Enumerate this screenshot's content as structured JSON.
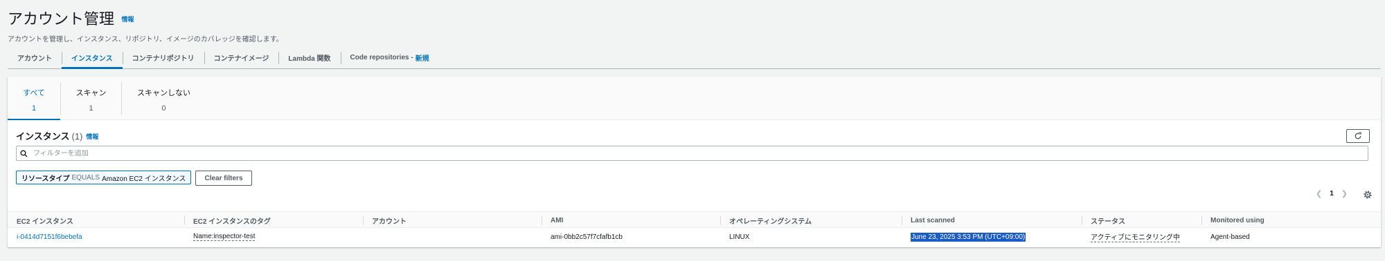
{
  "header": {
    "title": "アカウント管理",
    "info": "情報",
    "description": "アカウントを管理し、インスタンス、リポジトリ、イメージのカバレッジを確認します。"
  },
  "tabs": [
    {
      "label": "アカウント",
      "active": false
    },
    {
      "label": "インスタンス",
      "active": true
    },
    {
      "label": "コンテナリポジトリ",
      "active": false
    },
    {
      "label": "コンテナイメージ",
      "active": false
    },
    {
      "label": "Lambda 関数",
      "active": false
    },
    {
      "label": "Code repositories -",
      "suffix": "新規",
      "active": false
    }
  ],
  "segments": [
    {
      "label": "すべて",
      "count": "1",
      "active": true
    },
    {
      "label": "スキャン",
      "count": "1",
      "active": false
    },
    {
      "label": "スキャンしない",
      "count": "0",
      "active": false
    }
  ],
  "table": {
    "title": "インスタンス",
    "count": "(1)",
    "info": "情報",
    "search_placeholder": "フィルターを追加",
    "filter_token": {
      "key": "リソースタイプ",
      "operator": "EQUALS",
      "value": "Amazon EC2 インスタンス"
    },
    "clear_filters": "Clear filters",
    "page": "1",
    "columns": [
      "EC2 インスタンス",
      "EC2 インスタンスのタグ",
      "アカウント",
      "AMI",
      "オペレーティングシステム",
      "Last scanned",
      "ステータス",
      "Monitored using"
    ],
    "rows": [
      {
        "instance": "i-0414d7151f6bebefa",
        "tags": "Name:inspector-test",
        "account": "",
        "ami": "ami-0bb2c57f7cfafb1cb",
        "os": "LINUX",
        "last_scanned": "June 23, 2025 3:53 PM (UTC+09:00)",
        "status": "アクティブにモニタリング中",
        "monitored_using": "Agent-based"
      }
    ]
  },
  "icons": {
    "search": "search-icon",
    "refresh": "refresh-icon",
    "settings": "gear-icon",
    "prev": "chevron-left-icon",
    "next": "chevron-right-icon"
  },
  "colors": {
    "accent": "#0073bb",
    "background": "#f2f3f3",
    "selection": "#1a5bc6"
  }
}
